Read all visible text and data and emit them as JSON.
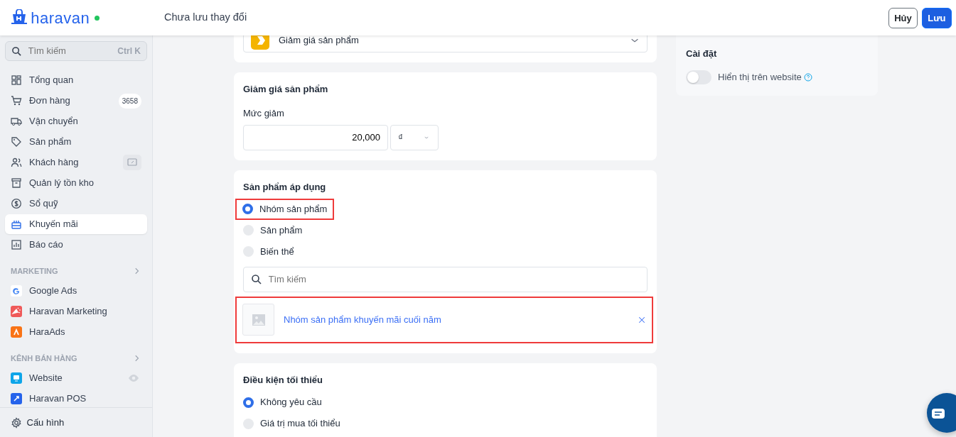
{
  "header": {
    "logo": "haravan",
    "online": true,
    "title": "Chưa lưu thay đổi",
    "buttons": [
      {
        "label": "Hủy",
        "kind": "secondary"
      },
      {
        "label": "Lưu",
        "kind": "primary"
      }
    ]
  },
  "sidebar": {
    "search": {
      "placeholder": "Tìm kiếm",
      "shortcut": "Ctrl K"
    },
    "items": [
      {
        "label": "Tổng quan",
        "selected": false
      },
      {
        "label": "Đơn hàng",
        "selected": false,
        "badge": "3658"
      },
      {
        "label": "Vận chuyển",
        "selected": false
      },
      {
        "label": "Sản phẩm",
        "selected": false
      },
      {
        "label": "Khách hàng",
        "selected": false
      },
      {
        "label": "Quản lý tồn kho",
        "selected": false
      },
      {
        "label": "Sổ quỹ",
        "selected": false
      },
      {
        "label": "Khuyến mãi",
        "selected": true
      },
      {
        "label": "Báo cáo",
        "selected": false
      }
    ],
    "sections": [
      {
        "title": "MARKETING",
        "items": [
          {
            "label": "Google Ads"
          },
          {
            "label": "Haravan Marketing"
          },
          {
            "label": "HaraAds"
          }
        ]
      },
      {
        "title": "KÊNH BÁN HÀNG",
        "items": [
          {
            "label": "Website"
          },
          {
            "label": "Haravan POS"
          }
        ]
      }
    ],
    "footer": {
      "label": "Cấu hình"
    }
  },
  "promotion_type": {
    "value": "Giảm giá sản phẩm"
  },
  "discount": {
    "title": "Giảm giá sản phẩm",
    "label": "Mức giảm",
    "value": "20,000",
    "unit": "₫"
  },
  "applies_to": {
    "title": "Sản phẩm áp dụng",
    "options": [
      {
        "label": "Nhóm sản phẩm",
        "selected": true,
        "highlighted": true
      },
      {
        "label": "Sản phẩm",
        "selected": false,
        "highlighted": false
      },
      {
        "label": "Biến thể",
        "selected": false,
        "highlighted": false
      }
    ],
    "search": {
      "placeholder": "Tìm kiếm"
    },
    "chosen": [
      {
        "label": "Nhóm sản phẩm khuyến mãi cuối năm",
        "highlighted": true
      }
    ]
  },
  "minimum": {
    "title": "Điều kiện tối thiểu",
    "options": [
      {
        "label": "Không yêu cầu",
        "selected": true
      },
      {
        "label": "Giá trị mua tối thiểu",
        "selected": false
      }
    ]
  },
  "settings": {
    "title": "Cài đặt",
    "toggle": {
      "label": "Hiển thị trên website",
      "on": false
    }
  }
}
